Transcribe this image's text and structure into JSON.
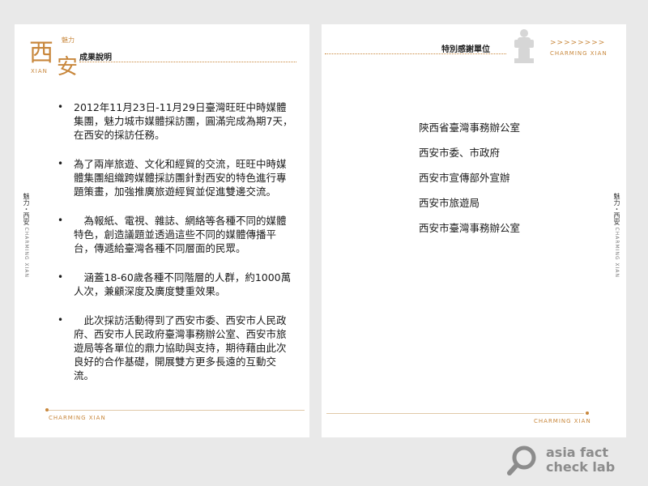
{
  "left_page": {
    "logo": {
      "main": "西",
      "small": "魅力",
      "main2": "安",
      "english": "XIAN"
    },
    "header_title": "成果說明",
    "side_tab": {
      "zh": "魅力・西安",
      "en": "CHARMING XIAN"
    },
    "bullets": [
      "2012年11月23日-11月29日臺灣旺旺中時媒體集團，魅力城市媒體採訪團，圓滿完成為期7天，在西安的採訪任務。",
      "為了兩岸旅遊、文化和經貿的交流，旺旺中時媒體集團組織跨媒體採訪團針對西安的特色進行專題策畫，加強推廣旅遊經貿並促進雙邊交流。",
      "　為報紙、電視、雜誌、網絡等各種不同的媒體特色，創造議題並透過這些不同的媒體傳播平台，傳遞給臺灣各種不同層面的民眾。",
      "　涵蓋18-60歲各種不同階層的人群，約1000萬人次，兼顧深度及廣度雙重效果。",
      "　此次採訪活動得到了西安市委、西安市人民政府、西安市人民政府臺灣事務辦公室、西安市旅遊局等各單位的鼎力協助與支持，期待藉由此次良好的合作基礎，開展雙方更多長遠的互動交流。"
    ],
    "footer": "CHARMING XIAN"
  },
  "right_page": {
    "header_title": "特別感謝單位",
    "arrows": ">>>>>>>>",
    "brand": "CHARMING XIAN",
    "side_tab": {
      "zh": "魅力・西安",
      "en": "CHARMING XIAN"
    },
    "thanks": [
      "陝西省臺灣事務辦公室",
      "西安市委、市政府",
      "西安市宣傳部外宣辦",
      "西安市旅遊局",
      "西安市臺灣事務辦公室"
    ],
    "footer": "CHARMING XIAN"
  },
  "watermark": {
    "line1": "asia fact",
    "line2": "check lab"
  },
  "colors": {
    "accent": "#c8873c",
    "background": "#e9e9e9",
    "page": "#ffffff",
    "watermark": "#8c8c8c"
  }
}
